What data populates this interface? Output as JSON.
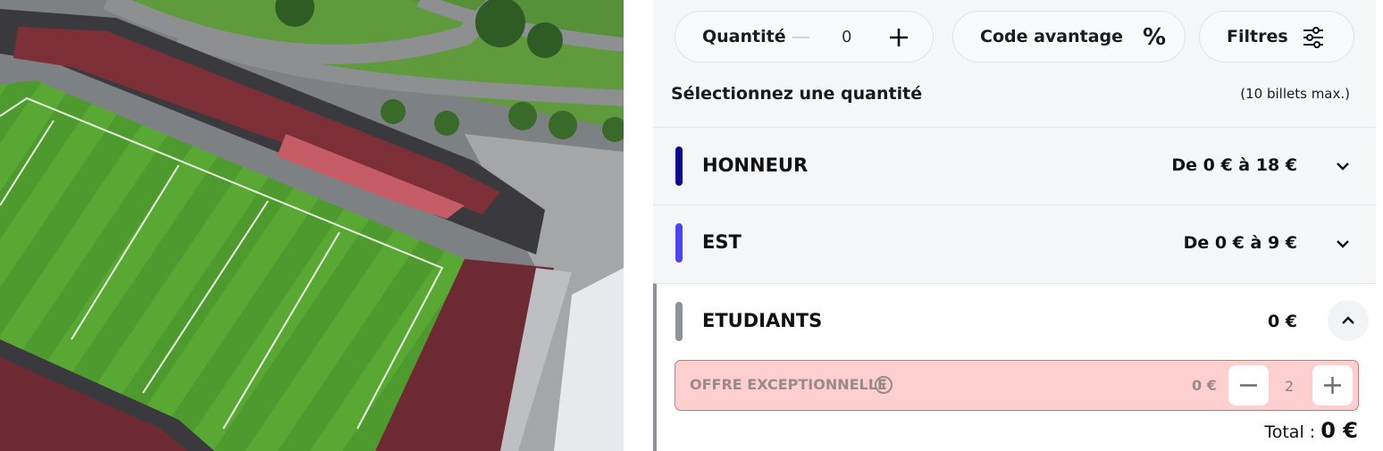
{
  "filters": {
    "quantity_label": "Quantité",
    "quantity_value": "0",
    "promo_label": "Code avantage",
    "promo_icon": "%",
    "filters_label": "Filtres"
  },
  "selection": {
    "hint": "Sélectionnez une quantité",
    "max": "(10 billets max.)"
  },
  "categories": [
    {
      "name": "HONNEUR",
      "price": "De 0 € à 18 €",
      "color": "#0c0a8c",
      "expanded": false
    },
    {
      "name": "EST",
      "price": "De 0 € à 9 €",
      "color": "#4c44ee",
      "expanded": false
    },
    {
      "name": "ETUDIANTS",
      "price": "0 €",
      "color": "#8d939b",
      "expanded": true
    }
  ],
  "offer": {
    "label": "OFFRE EXCEPTIONNELLE",
    "price": "0 €",
    "quantity": "2"
  },
  "total": {
    "label": "Total :",
    "value": "0 €"
  }
}
